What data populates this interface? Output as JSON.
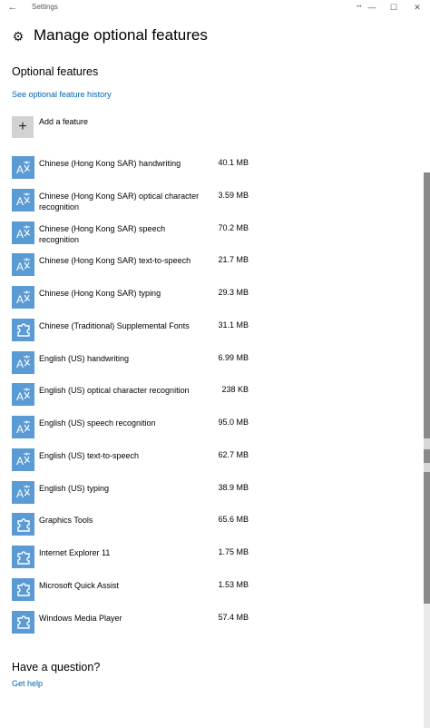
{
  "window": {
    "title": "Settings",
    "back_glyph": "←",
    "minimize_glyph": "—",
    "maximize_glyph": "☐",
    "close_glyph": "✕",
    "resize_glyph": "↔"
  },
  "header": {
    "icon": "gear-icon",
    "title": "Manage optional features"
  },
  "section": {
    "title": "Optional features",
    "history_link": "See optional feature history"
  },
  "add_feature": {
    "label": "Add a feature",
    "glyph": "+"
  },
  "features": [
    {
      "name": "Chinese (Hong Kong SAR) handwriting",
      "size": "40.1 MB",
      "icon": "language-icon"
    },
    {
      "name": "Chinese (Hong Kong SAR) optical character recognition",
      "size": "3.59 MB",
      "icon": "language-icon"
    },
    {
      "name": "Chinese (Hong Kong SAR) speech recognition",
      "size": "70.2 MB",
      "icon": "language-icon"
    },
    {
      "name": "Chinese (Hong Kong SAR) text-to-speech",
      "size": "21.7 MB",
      "icon": "language-icon"
    },
    {
      "name": "Chinese (Hong Kong SAR) typing",
      "size": "29.3 MB",
      "icon": "language-icon"
    },
    {
      "name": "Chinese (Traditional) Supplemental Fonts",
      "size": "31.1 MB",
      "icon": "puzzle-icon"
    },
    {
      "name": "English (US) handwriting",
      "size": "6.99 MB",
      "icon": "language-icon"
    },
    {
      "name": "English (US) optical character recognition",
      "size": "238 KB",
      "icon": "language-icon"
    },
    {
      "name": "English (US) speech recognition",
      "size": "95.0 MB",
      "icon": "language-icon"
    },
    {
      "name": "English (US) text-to-speech",
      "size": "62.7 MB",
      "icon": "language-icon"
    },
    {
      "name": "English (US) typing",
      "size": "38.9 MB",
      "icon": "language-icon"
    },
    {
      "name": "Graphics Tools",
      "size": "65.6 MB",
      "icon": "puzzle-icon"
    },
    {
      "name": "Internet Explorer 11",
      "size": "1.75 MB",
      "icon": "puzzle-icon"
    },
    {
      "name": "Microsoft Quick Assist",
      "size": "1.53 MB",
      "icon": "puzzle-icon"
    },
    {
      "name": "Windows Media Player",
      "size": "57.4 MB",
      "icon": "puzzle-icon"
    }
  ],
  "help": {
    "title": "Have a question?",
    "link": "Get help"
  },
  "colors": {
    "accent": "#0063b1",
    "tile": "#5b9bd5"
  }
}
